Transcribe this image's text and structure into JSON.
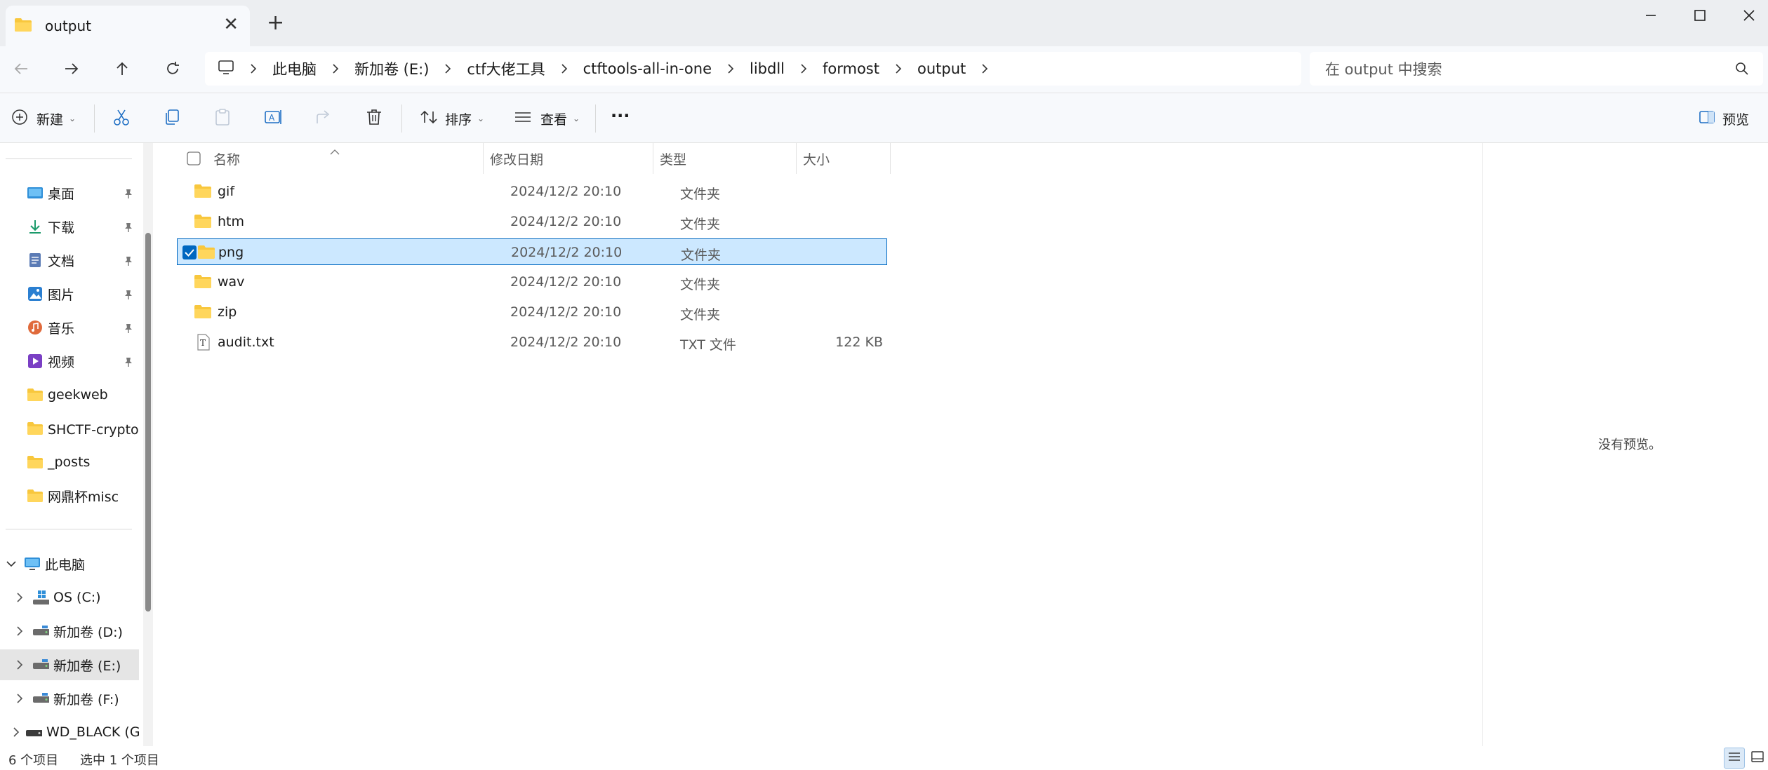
{
  "window": {
    "tab_title": "output",
    "new_tab_label": "+",
    "close_tab_label": "✕"
  },
  "address": {
    "crumbs": [
      "此电脑",
      "新加卷 (E:)",
      "ctf大佬工具",
      "ctftools-all-in-one",
      "libdll",
      "formost",
      "output"
    ]
  },
  "search": {
    "placeholder": "在 output 中搜索"
  },
  "toolbar": {
    "new_label": "新建",
    "sort_label": "排序",
    "view_label": "查看",
    "more_label": "···",
    "preview_label": "预览"
  },
  "sidebar": {
    "quick": [
      {
        "label": "桌面",
        "icon": "desktop-icon",
        "pinned": true
      },
      {
        "label": "下载",
        "icon": "download-icon",
        "pinned": true
      },
      {
        "label": "文档",
        "icon": "document-icon",
        "pinned": true
      },
      {
        "label": "图片",
        "icon": "pictures-icon",
        "pinned": true
      },
      {
        "label": "音乐",
        "icon": "music-icon",
        "pinned": true
      },
      {
        "label": "视频",
        "icon": "video-icon",
        "pinned": true
      },
      {
        "label": "geekweb",
        "icon": "folder-icon",
        "pinned": false
      },
      {
        "label": "SHCTF-crypto复",
        "icon": "folder-icon",
        "pinned": false
      },
      {
        "label": "_posts",
        "icon": "folder-icon",
        "pinned": false
      },
      {
        "label": "网鼎杯misc",
        "icon": "folder-icon",
        "pinned": false
      }
    ],
    "this_pc_label": "此电脑",
    "drives": [
      {
        "label": "OS (C:)",
        "icon": "os-drive-icon",
        "selected": false
      },
      {
        "label": "新加卷 (D:)",
        "icon": "drive-icon",
        "selected": false
      },
      {
        "label": "新加卷 (E:)",
        "icon": "drive-icon",
        "selected": true
      },
      {
        "label": "新加卷 (F:)",
        "icon": "drive-icon",
        "selected": false
      },
      {
        "label": "WD_BLACK (G",
        "icon": "drive-icon",
        "selected": false
      }
    ]
  },
  "columns": {
    "name": "名称",
    "date": "修改日期",
    "type": "类型",
    "size": "大小"
  },
  "files": [
    {
      "name": "gif",
      "date": "2024/12/2 20:10",
      "type": "文件夹",
      "size": "",
      "kind": "folder",
      "selected": false
    },
    {
      "name": "htm",
      "date": "2024/12/2 20:10",
      "type": "文件夹",
      "size": "",
      "kind": "folder",
      "selected": false
    },
    {
      "name": "png",
      "date": "2024/12/2 20:10",
      "type": "文件夹",
      "size": "",
      "kind": "folder",
      "selected": true
    },
    {
      "name": "wav",
      "date": "2024/12/2 20:10",
      "type": "文件夹",
      "size": "",
      "kind": "folder",
      "selected": false
    },
    {
      "name": "zip",
      "date": "2024/12/2 20:10",
      "type": "文件夹",
      "size": "",
      "kind": "folder",
      "selected": false
    },
    {
      "name": "audit.txt",
      "date": "2024/12/2 20:10",
      "type": "TXT 文件",
      "size": "122 KB",
      "kind": "text",
      "selected": false
    }
  ],
  "preview": {
    "empty_text": "没有预览。"
  },
  "status": {
    "item_count": "6 个项目",
    "selected_count": "选中 1 个项目"
  },
  "colors": {
    "accent": "#0067c0",
    "selection": "#cce8ff",
    "folder": "#f8c73d"
  }
}
